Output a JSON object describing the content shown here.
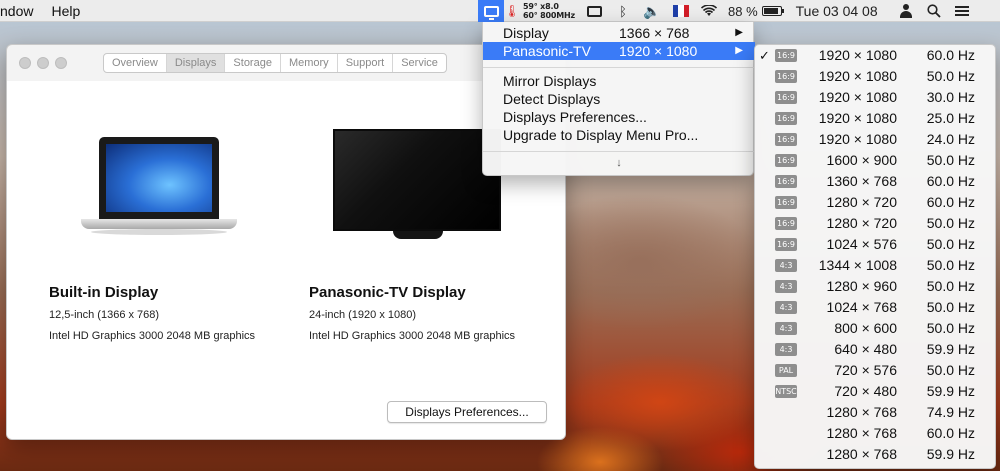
{
  "menubar": {
    "left_items": [
      "ndow",
      "Help"
    ],
    "stats_line1": "59° x8.0",
    "stats_line2": "60° 800MHz",
    "battery_text": "88 %",
    "battery_level": 0.88,
    "datetime": "Tue 03 04 08",
    "icons": [
      "display-menu-icon",
      "thermometer-icon",
      "screen-mirror-icon",
      "bluetooth-icon",
      "volume-icon",
      "flag-icon",
      "wifi-icon",
      "battery-icon",
      "user-icon",
      "search-icon",
      "list-icon"
    ],
    "flag_colors": [
      "#1f3fa8",
      "#ffffff",
      "#d21d27"
    ]
  },
  "window": {
    "tabs": [
      "Overview",
      "Displays",
      "Storage",
      "Memory",
      "Support",
      "Service"
    ],
    "active_tab": "Displays",
    "builtin": {
      "name": "Built-in Display",
      "size": "12,5-inch (1366 x 768)",
      "gpu": "Intel HD Graphics 3000 2048 MB graphics"
    },
    "tv": {
      "name": "Panasonic-TV Display",
      "size": "24-inch (1920 x 1080)",
      "gpu": "Intel HD Graphics 3000 2048 MB graphics"
    },
    "prefs_button": "Displays Preferences..."
  },
  "menu": {
    "display_label": "Display",
    "display_res": "1366 × 768",
    "tv_label": "Panasonic-TV",
    "tv_res": "1920 × 1080",
    "mirror": "Mirror Displays",
    "detect": "Detect Displays",
    "preferences": "Displays Preferences...",
    "upgrade": "Upgrade to Display Menu Pro...",
    "more_arrow": "↓",
    "submenu_arrow": "▶",
    "highlight_color": "#3a7bf7"
  },
  "modes": [
    {
      "tag": "16:9",
      "res": "1920 × 1080",
      "hz": "60.0 Hz",
      "checked": true
    },
    {
      "tag": "16:9",
      "res": "1920 × 1080",
      "hz": "50.0 Hz",
      "checked": false
    },
    {
      "tag": "16:9",
      "res": "1920 × 1080",
      "hz": "30.0 Hz",
      "checked": false
    },
    {
      "tag": "16:9",
      "res": "1920 × 1080",
      "hz": "25.0 Hz",
      "checked": false
    },
    {
      "tag": "16:9",
      "res": "1920 × 1080",
      "hz": "24.0 Hz",
      "checked": false
    },
    {
      "tag": "16:9",
      "res": "1600 × 900",
      "hz": "50.0 Hz",
      "checked": false
    },
    {
      "tag": "16:9",
      "res": "1360 × 768",
      "hz": "60.0 Hz",
      "checked": false
    },
    {
      "tag": "16:9",
      "res": "1280 × 720",
      "hz": "60.0 Hz",
      "checked": false
    },
    {
      "tag": "16:9",
      "res": "1280 × 720",
      "hz": "50.0 Hz",
      "checked": false
    },
    {
      "tag": "16:9",
      "res": "1024 × 576",
      "hz": "50.0 Hz",
      "checked": false
    },
    {
      "tag": "4:3",
      "res": "1344 × 1008",
      "hz": "50.0 Hz",
      "checked": false
    },
    {
      "tag": "4:3",
      "res": "1280 × 960",
      "hz": "50.0 Hz",
      "checked": false
    },
    {
      "tag": "4:3",
      "res": "1024 × 768",
      "hz": "50.0 Hz",
      "checked": false
    },
    {
      "tag": "4:3",
      "res": "800 × 600",
      "hz": "50.0 Hz",
      "checked": false
    },
    {
      "tag": "4:3",
      "res": "640 × 480",
      "hz": "59.9 Hz",
      "checked": false
    },
    {
      "tag": "PAL",
      "res": "720 × 576",
      "hz": "50.0 Hz",
      "checked": false
    },
    {
      "tag": "NTSC",
      "res": "720 × 480",
      "hz": "59.9 Hz",
      "checked": false
    },
    {
      "tag": "",
      "res": "1280 × 768",
      "hz": "74.9 Hz",
      "checked": false
    },
    {
      "tag": "",
      "res": "1280 × 768",
      "hz": "60.0 Hz",
      "checked": false
    },
    {
      "tag": "",
      "res": "1280 × 768",
      "hz": "59.9 Hz",
      "checked": false
    }
  ],
  "check_glyph": "✓"
}
